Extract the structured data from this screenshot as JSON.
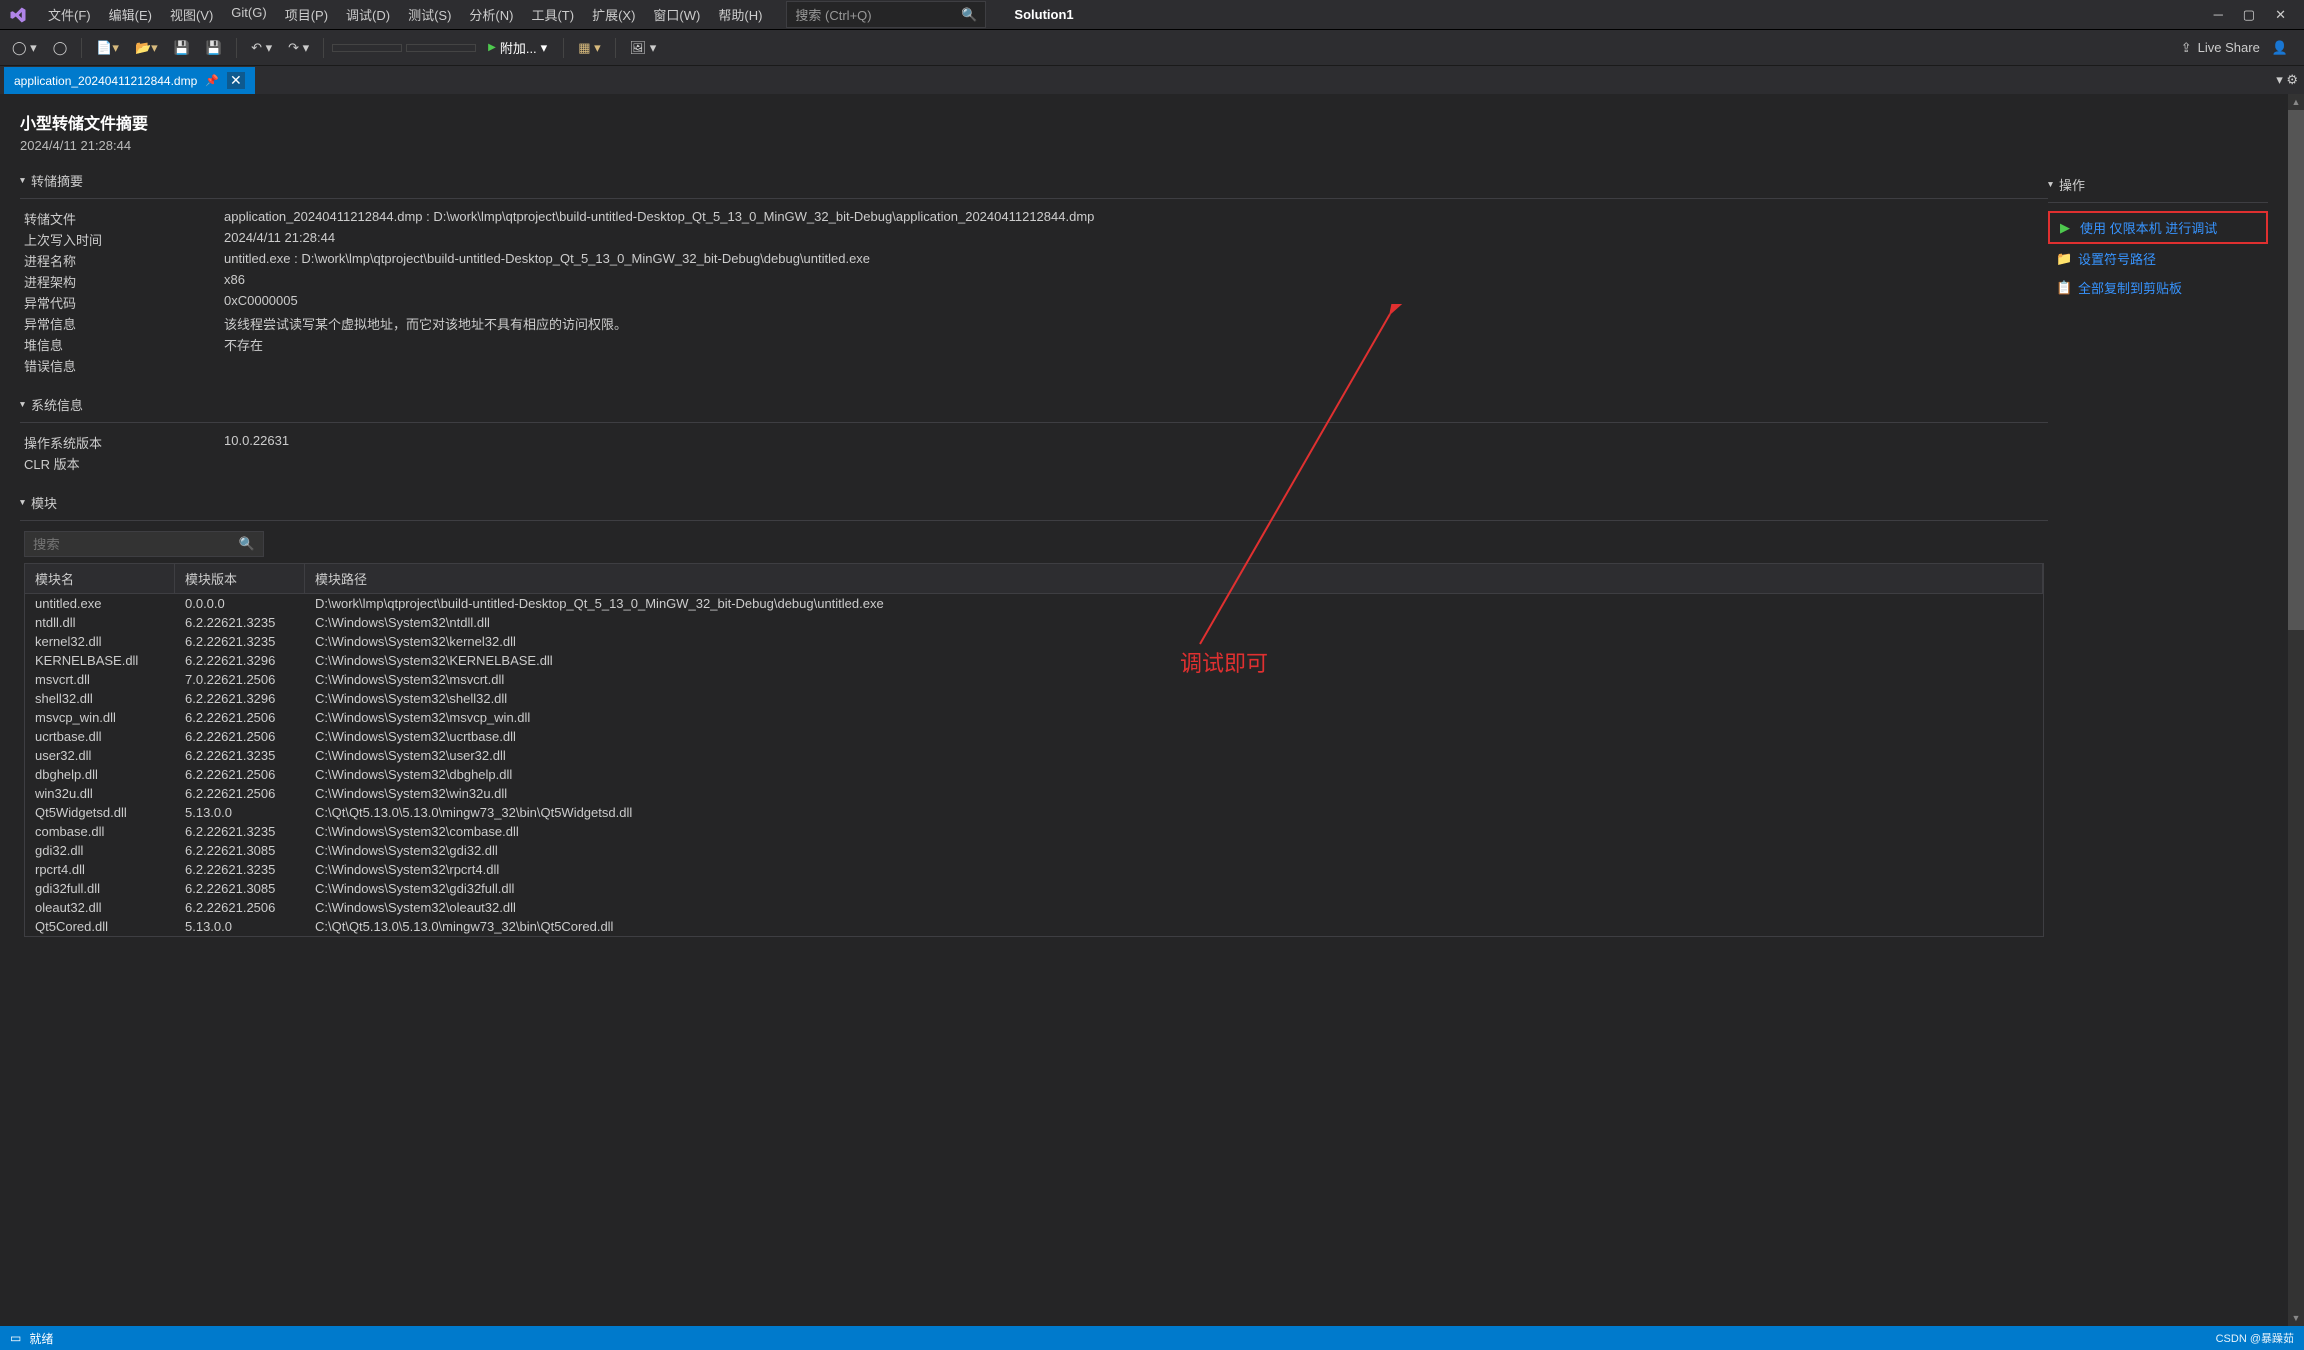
{
  "menubar": [
    "文件(F)",
    "编辑(E)",
    "视图(V)",
    "Git(G)",
    "项目(P)",
    "调试(D)",
    "测试(S)",
    "分析(N)",
    "工具(T)",
    "扩展(X)",
    "窗口(W)",
    "帮助(H)"
  ],
  "search_placeholder": "搜索 (Ctrl+Q)",
  "solution": "Solution1",
  "toolbar": {
    "attach": "附加...",
    "live_share": "Live Share"
  },
  "tab": {
    "name": "application_20240411212844.dmp"
  },
  "header": {
    "title": "小型转储文件摘要",
    "subtitle": "2024/4/11 21:28:44"
  },
  "sections": {
    "dump": "转储摘要",
    "sys": "系统信息",
    "mod": "模块",
    "actions": "操作"
  },
  "dump": {
    "rows": [
      [
        "转储文件",
        "application_20240411212844.dmp : D:\\work\\lmp\\qtproject\\build-untitled-Desktop_Qt_5_13_0_MinGW_32_bit-Debug\\application_20240411212844.dmp"
      ],
      [
        "上次写入时间",
        "2024/4/11 21:28:44"
      ],
      [
        "进程名称",
        "untitled.exe : D:\\work\\lmp\\qtproject\\build-untitled-Desktop_Qt_5_13_0_MinGW_32_bit-Debug\\debug\\untitled.exe"
      ],
      [
        "进程架构",
        "x86"
      ],
      [
        "异常代码",
        "0xC0000005"
      ],
      [
        "异常信息",
        "该线程尝试读写某个虚拟地址，而它对该地址不具有相应的访问权限。"
      ],
      [
        "堆信息",
        "不存在"
      ],
      [
        "错误信息",
        ""
      ]
    ]
  },
  "sys": {
    "rows": [
      [
        "操作系统版本",
        "10.0.22631"
      ],
      [
        "CLR 版本",
        ""
      ]
    ]
  },
  "actions": {
    "debug_native": "使用 仅限本机 进行调试",
    "set_symbol": "设置符号路径",
    "copy_all": "全部复制到剪贴板"
  },
  "mod_search_placeholder": "搜索",
  "mod_headers": [
    "模块名",
    "模块版本",
    "模块路径"
  ],
  "modules": [
    [
      "untitled.exe",
      "0.0.0.0",
      "D:\\work\\lmp\\qtproject\\build-untitled-Desktop_Qt_5_13_0_MinGW_32_bit-Debug\\debug\\untitled.exe"
    ],
    [
      "ntdll.dll",
      "6.2.22621.3235",
      "C:\\Windows\\System32\\ntdll.dll"
    ],
    [
      "kernel32.dll",
      "6.2.22621.3235",
      "C:\\Windows\\System32\\kernel32.dll"
    ],
    [
      "KERNELBASE.dll",
      "6.2.22621.3296",
      "C:\\Windows\\System32\\KERNELBASE.dll"
    ],
    [
      "msvcrt.dll",
      "7.0.22621.2506",
      "C:\\Windows\\System32\\msvcrt.dll"
    ],
    [
      "shell32.dll",
      "6.2.22621.3296",
      "C:\\Windows\\System32\\shell32.dll"
    ],
    [
      "msvcp_win.dll",
      "6.2.22621.2506",
      "C:\\Windows\\System32\\msvcp_win.dll"
    ],
    [
      "ucrtbase.dll",
      "6.2.22621.2506",
      "C:\\Windows\\System32\\ucrtbase.dll"
    ],
    [
      "user32.dll",
      "6.2.22621.3235",
      "C:\\Windows\\System32\\user32.dll"
    ],
    [
      "dbghelp.dll",
      "6.2.22621.2506",
      "C:\\Windows\\System32\\dbghelp.dll"
    ],
    [
      "win32u.dll",
      "6.2.22621.2506",
      "C:\\Windows\\System32\\win32u.dll"
    ],
    [
      "Qt5Widgetsd.dll",
      "5.13.0.0",
      "C:\\Qt\\Qt5.13.0\\5.13.0\\mingw73_32\\bin\\Qt5Widgetsd.dll"
    ],
    [
      "combase.dll",
      "6.2.22621.3235",
      "C:\\Windows\\System32\\combase.dll"
    ],
    [
      "gdi32.dll",
      "6.2.22621.3085",
      "C:\\Windows\\System32\\gdi32.dll"
    ],
    [
      "rpcrt4.dll",
      "6.2.22621.3235",
      "C:\\Windows\\System32\\rpcrt4.dll"
    ],
    [
      "gdi32full.dll",
      "6.2.22621.3085",
      "C:\\Windows\\System32\\gdi32full.dll"
    ],
    [
      "oleaut32.dll",
      "6.2.22621.2506",
      "C:\\Windows\\System32\\oleaut32.dll"
    ],
    [
      "Qt5Cored.dll",
      "5.13.0.0",
      "C:\\Qt\\Qt5.13.0\\5.13.0\\mingw73_32\\bin\\Qt5Cored.dll"
    ]
  ],
  "annotation": "调试即可",
  "status": {
    "ready": "就绪",
    "watermark": "CSDN @暴躁茹"
  }
}
